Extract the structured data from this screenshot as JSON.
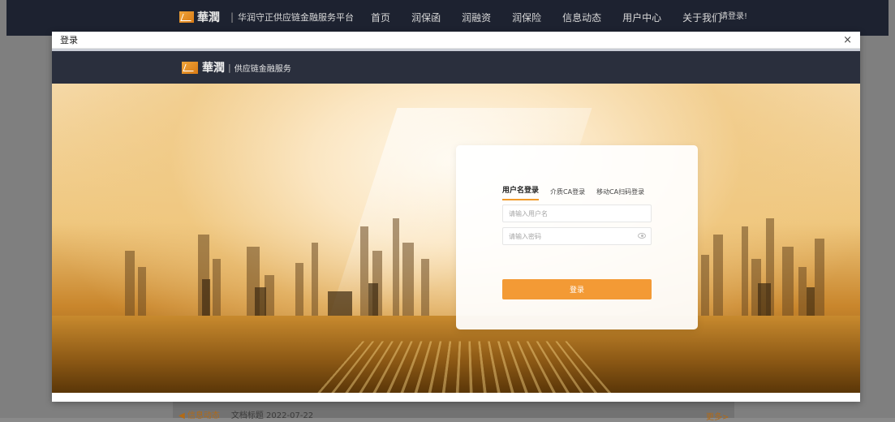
{
  "background": {
    "logo_text": "華潤",
    "platform_name": "华润守正供应链金融服务平台",
    "nav_items": [
      "首页",
      "润保函",
      "润融资",
      "润保险",
      "信息动态",
      "用户中心",
      "关于我们"
    ],
    "login_prompt": "请登录!",
    "news_tag": "◀ 信息动态",
    "news_item": "文档标题 2022-07-22",
    "more_link": "更多>"
  },
  "dialog": {
    "title": "登录",
    "close_glyph": "×",
    "header": {
      "logo_text": "華潤",
      "divider": "|",
      "service_name": "供应链金融服务"
    }
  },
  "login": {
    "tabs": [
      {
        "label": "用户名登录",
        "active": true
      },
      {
        "label": "介质CA登录",
        "active": false
      },
      {
        "label": "移动CA扫码登录",
        "active": false
      }
    ],
    "username_placeholder": "请输入用户名",
    "password_placeholder": "请输入密码",
    "submit_label": "登录"
  },
  "colors": {
    "accent": "#f39a35",
    "header_dark": "#2a2f3d",
    "topbar": "#1d2230"
  },
  "icons": [
    "logo-icon",
    "close-icon",
    "eye-icon"
  ]
}
